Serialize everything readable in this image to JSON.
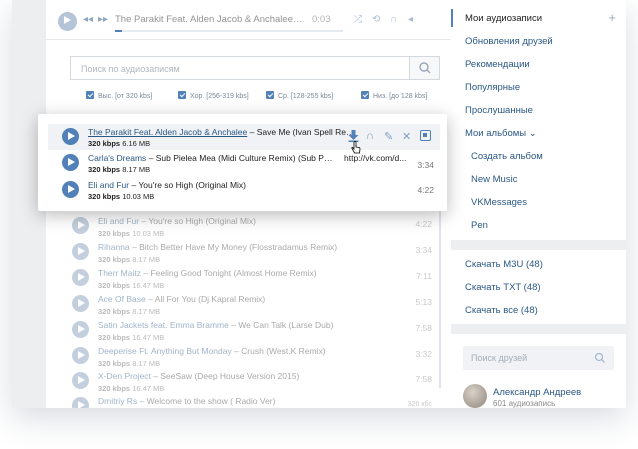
{
  "player": {
    "title": "The Parakit Feat. Alden Jacob & Anchalee – Save Me (Ivan Spell Remix)",
    "time": "0:03",
    "progress": 0.03
  },
  "search": {
    "placeholder": "Поиск по аудиозаписям"
  },
  "filters": [
    {
      "label": "Выс. [от 320 kbs]",
      "checked": true
    },
    {
      "label": "Хор. [256-319 kbs]",
      "checked": true
    },
    {
      "label": "Ср. [128-255 kbs]",
      "checked": true
    },
    {
      "label": "Низ. [до 128 kbs]",
      "checked": true
    }
  ],
  "popup": {
    "rows": [
      {
        "artist": "The Parakit Feat. Alden Jacob & Anchalee",
        "title": "Save Me (Ivan Spell Remix)",
        "bitrate": "320 kbps",
        "size": "6.16 MB",
        "duration": ""
      },
      {
        "artist": "Carla's Dreams",
        "title": "Sub Pielea Mea (Midi Culture Remix) (Sub Pielea Mea)",
        "bitrate": "320 kbps",
        "size": "8.17 MB",
        "duration": "3:34",
        "url": "http://vk.com/d..."
      },
      {
        "artist": "Eli and Fur",
        "title": "You're so High (Original Mix)",
        "bitrate": "320 kbps",
        "size": "10.03 MB",
        "duration": "4:22"
      }
    ]
  },
  "tracks": [
    {
      "artist": "Eli and Fur",
      "title": "You're so High (Original Mix)",
      "bitrate": "320 kbps",
      "size": "10.03 MB",
      "duration": "4:22"
    },
    {
      "artist": "Rihanna",
      "title": "Bitch Better Have My Money (Flosstradamus Remix)",
      "bitrate": "320 kbps",
      "size": "8.17 MB",
      "duration": "3:34"
    },
    {
      "artist": "Therr Maitz",
      "title": "Feeling Good Tonight (Almost Home Remix)",
      "bitrate": "320 kbps",
      "size": "16.47 MB",
      "duration": "7:11"
    },
    {
      "artist": "Ace Of Base",
      "title": "All For You (Dj Kapral Remix)",
      "bitrate": "320 kbps",
      "size": "8.17 MB",
      "duration": "5:13"
    },
    {
      "artist": "Satin Jackets feat. Emma Bramme",
      "title": "We Can Talk (Larse Dub)",
      "bitrate": "320 kbps",
      "size": "16.47 MB",
      "duration": "7:58"
    },
    {
      "artist": "Deeperise Ft. Anything But Monday",
      "title": "Crush (West.K Remix)",
      "bitrate": "320 kbps",
      "size": "8.17 MB",
      "duration": "3:32"
    },
    {
      "artist": "X-Den Project",
      "title": "SeeSaw (Deep House Version 2015)",
      "bitrate": "320 kbps",
      "size": "16.47 MB",
      "duration": "7:58"
    },
    {
      "artist": "Dmitriy Rs",
      "title": "Welcome to the show ( Radio Ver)",
      "bitrate": "",
      "size": "",
      "duration": "320 кбс"
    }
  ],
  "sidebar": {
    "menu": [
      {
        "label": "Мои аудиозаписи",
        "selected": true
      },
      {
        "label": "Обновления друзей"
      },
      {
        "label": "Рекомендации"
      },
      {
        "label": "Популярные"
      },
      {
        "label": "Прослушанные"
      },
      {
        "label": "Мои альбомы ⌄"
      }
    ],
    "albums": [
      "Создать альбом",
      "New Music",
      "VKMessages",
      "Pen"
    ],
    "downloads": [
      "Скачать M3U (48)",
      "Скачать TXT (48)",
      "Скачать все (48)"
    ],
    "friends_search_placeholder": "Поиск друзей",
    "friend": {
      "name": "Александр Андреев",
      "subtitle": "601 аудиозапись"
    }
  },
  "colors": {
    "accent": "#5181b8",
    "link": "#2a5885",
    "background": "#edeef0"
  }
}
